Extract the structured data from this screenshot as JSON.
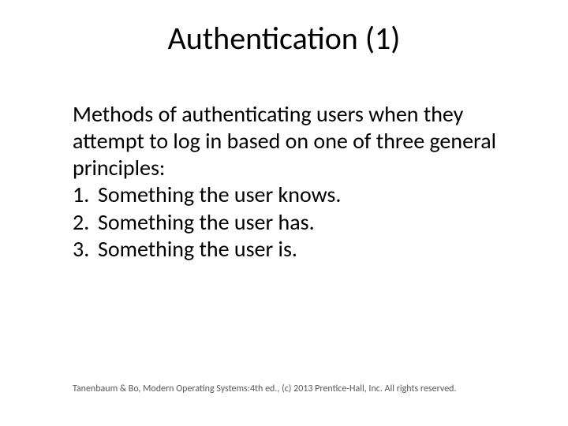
{
  "title": "Authentication (1)",
  "intro": "Methods of authenticating users when they attempt to log in based on one of three general principles:",
  "items": [
    {
      "num": "1.",
      "text": "Something the user knows."
    },
    {
      "num": "2.",
      "text": "Something the user has."
    },
    {
      "num": "3.",
      "text": "Something the user is."
    }
  ],
  "footer": "Tanenbaum & Bo, Modern Operating Systems:4th ed., (c) 2013 Prentice-Hall, Inc. All rights reserved."
}
